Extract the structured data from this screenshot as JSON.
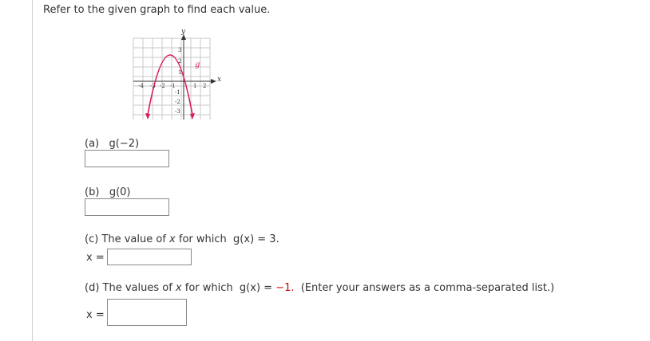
{
  "prompt": "Refer to the given graph to find each value.",
  "graph": {
    "y_axis_label": "y",
    "x_axis_label": "x",
    "curve_label": "g",
    "x_ticks": [
      "-4",
      "-3",
      "-2",
      "-1",
      "1",
      "2"
    ],
    "y_ticks": [
      "3",
      "2",
      "1",
      "-1",
      "-2",
      "-3"
    ],
    "curve_color": "#d81b60"
  },
  "parts": {
    "a": {
      "tag": "(a)",
      "expr": "g(−2)",
      "value": ""
    },
    "b": {
      "tag": "(b)",
      "expr": "g(0)",
      "value": ""
    },
    "c": {
      "text_pre": "(c) The value of ",
      "var": "x",
      "text_mid": " for which ",
      "expr": "g(x)",
      "text_post": " = 3.",
      "x_label": "x =",
      "value": ""
    },
    "d": {
      "text_pre": "(d) The values of ",
      "var": "x",
      "text_mid": " for which ",
      "expr": "g(x)",
      "eq": " = ",
      "rhs": "−1.",
      "note": "  (Enter your answers as a comma-separated list.)",
      "x_label": "x =",
      "value": ""
    }
  }
}
